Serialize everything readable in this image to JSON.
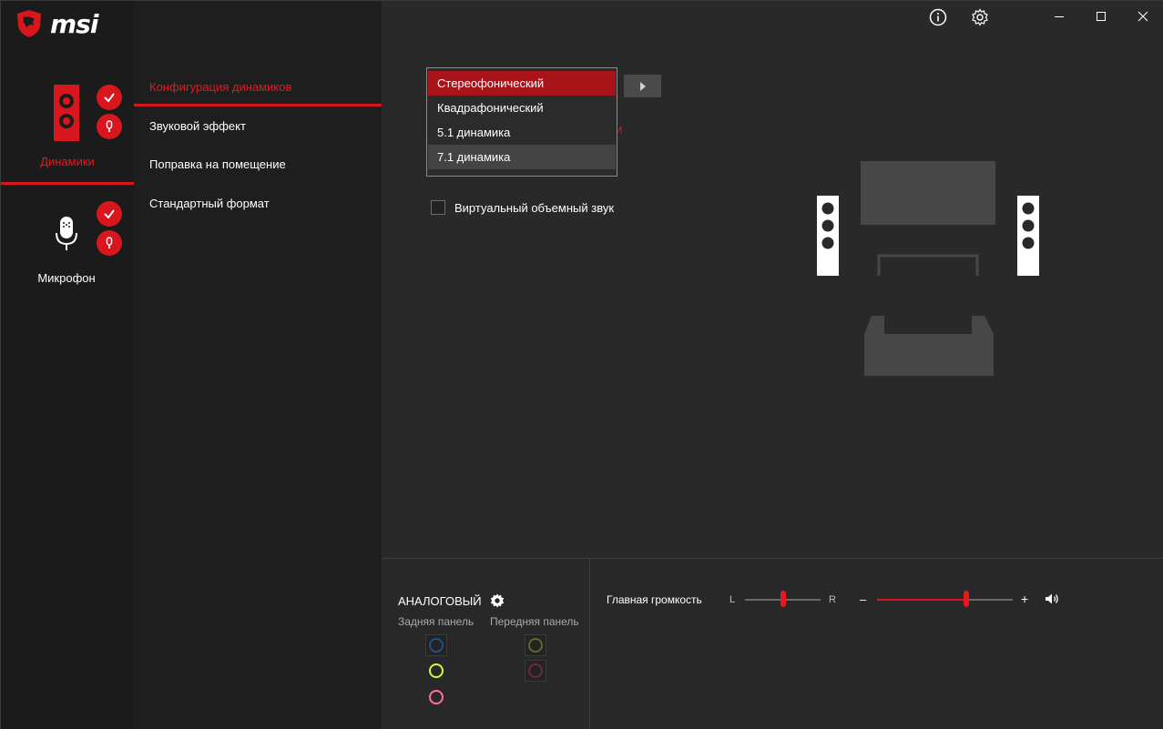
{
  "brand": {
    "logo_text": "msi"
  },
  "devices": [
    {
      "label": "Динамики",
      "active": true
    },
    {
      "label": "Микрофон",
      "active": false
    }
  ],
  "menu": {
    "items": [
      {
        "label": "Конфигурация динамиков",
        "active": true
      },
      {
        "label": "Звуковой эффект",
        "active": false
      },
      {
        "label": "Поправка на помещение",
        "active": false
      },
      {
        "label": "Стандартный формат",
        "active": false
      }
    ]
  },
  "speaker_config": {
    "dropdown_options": [
      "Стереофонический",
      "Квадрафонический",
      "5.1 динамика",
      "7.1 динамика"
    ],
    "selected": "Стереофонический",
    "hovered": "7.1 динамика",
    "partial_red_text": "и",
    "virtual_surround_label": "Виртуальный объемный звук",
    "virtual_surround_checked": false
  },
  "bottom": {
    "analog_label": "АНАЛОГОВЫЙ",
    "rear_panel_label": "Задняя панель",
    "front_panel_label": "Передняя панель",
    "master_volume_label": "Главная громкость",
    "balance_left": "L",
    "balance_right": "R",
    "balance_value": 0.5,
    "volume_minus": "–",
    "volume_plus": "+",
    "volume_value": 0.66
  },
  "colors": {
    "accent": "#d8161d",
    "jack_blue": "#1f4f8f",
    "jack_green": "#c8ff3a",
    "jack_pink": "#ff6fa0",
    "jack_front_green": "#5b6b2a",
    "jack_front_pink": "#6b2a3a"
  },
  "icons": [
    "msi-dragon-icon",
    "speaker-device-icon",
    "microphone-device-icon",
    "check-icon",
    "mic-test-icon",
    "info-icon",
    "settings-icon",
    "minimize-icon",
    "maximize-icon",
    "close-icon",
    "play-arrow-icon",
    "gear-icon",
    "volume-icon"
  ]
}
